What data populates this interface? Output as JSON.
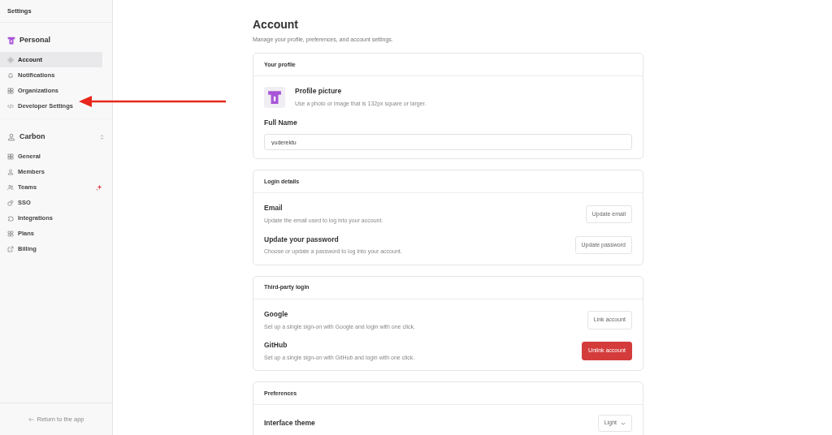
{
  "sidebar": {
    "title": "Settings",
    "sections": [
      {
        "name": "Personal",
        "switcher": false,
        "items": [
          {
            "label": "Account",
            "selected": true,
            "sparkle": false
          },
          {
            "label": "Notifications",
            "selected": false,
            "sparkle": false
          },
          {
            "label": "Organizations",
            "selected": false,
            "sparkle": false
          },
          {
            "label": "Developer Settings",
            "selected": false,
            "sparkle": false
          }
        ]
      },
      {
        "name": "Carbon",
        "switcher": true,
        "items": [
          {
            "label": "General",
            "selected": false,
            "sparkle": false
          },
          {
            "label": "Members",
            "selected": false,
            "sparkle": false
          },
          {
            "label": "Teams",
            "selected": false,
            "sparkle": true
          },
          {
            "label": "SSO",
            "selected": false,
            "sparkle": false
          },
          {
            "label": "Integrations",
            "selected": false,
            "sparkle": false
          },
          {
            "label": "Plans",
            "selected": false,
            "sparkle": false
          },
          {
            "label": "Billing",
            "selected": false,
            "sparkle": false
          }
        ]
      }
    ],
    "footer": "Return to the app"
  },
  "page": {
    "title": "Account",
    "subtitle": "Manage your profile, preferences, and account settings.",
    "cards": [
      {
        "title": "Your profile",
        "rows": [
          {
            "kind": "avatar",
            "label": "Profile picture",
            "description": "Use a photo or image that is 132px square or larger."
          },
          {
            "kind": "field",
            "label": "Full Name",
            "value": "yuderektu"
          }
        ]
      },
      {
        "title": "Login details",
        "rows": [
          {
            "kind": "action",
            "label": "Email",
            "description": "Update the email used to log into your account.",
            "button": "Update email",
            "danger": false
          },
          {
            "kind": "action",
            "label": "Update your password",
            "description": "Choose or update a password to log into your account.",
            "button": "Update password",
            "danger": false
          }
        ]
      },
      {
        "title": "Third-party login",
        "rows": [
          {
            "kind": "action",
            "label": "Google",
            "description": "Set up a single sign-on with Google and login with one click.",
            "button": "Link account",
            "danger": false
          },
          {
            "kind": "action",
            "label": "GitHub",
            "description": "Set up a single sign-on with GitHub and login with one click.",
            "button": "Unlink account",
            "danger": true
          }
        ]
      },
      {
        "title": "Preferences",
        "rows": [
          {
            "kind": "select",
            "label": "Interface theme",
            "value": "Light"
          }
        ]
      }
    ]
  },
  "annotation": {
    "arrow": true
  }
}
